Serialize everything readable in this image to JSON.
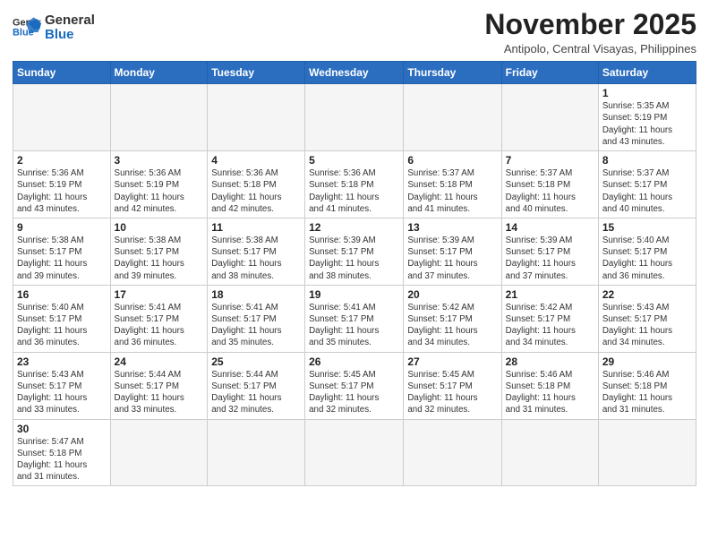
{
  "header": {
    "logo_line1": "General",
    "logo_line2": "Blue",
    "month_title": "November 2025",
    "subtitle": "Antipolo, Central Visayas, Philippines"
  },
  "weekdays": [
    "Sunday",
    "Monday",
    "Tuesday",
    "Wednesday",
    "Thursday",
    "Friday",
    "Saturday"
  ],
  "weeks": [
    [
      {
        "day": "",
        "info": ""
      },
      {
        "day": "",
        "info": ""
      },
      {
        "day": "",
        "info": ""
      },
      {
        "day": "",
        "info": ""
      },
      {
        "day": "",
        "info": ""
      },
      {
        "day": "",
        "info": ""
      },
      {
        "day": "1",
        "info": "Sunrise: 5:35 AM\nSunset: 5:19 PM\nDaylight: 11 hours\nand 43 minutes."
      }
    ],
    [
      {
        "day": "2",
        "info": "Sunrise: 5:36 AM\nSunset: 5:19 PM\nDaylight: 11 hours\nand 43 minutes."
      },
      {
        "day": "3",
        "info": "Sunrise: 5:36 AM\nSunset: 5:19 PM\nDaylight: 11 hours\nand 42 minutes."
      },
      {
        "day": "4",
        "info": "Sunrise: 5:36 AM\nSunset: 5:18 PM\nDaylight: 11 hours\nand 42 minutes."
      },
      {
        "day": "5",
        "info": "Sunrise: 5:36 AM\nSunset: 5:18 PM\nDaylight: 11 hours\nand 41 minutes."
      },
      {
        "day": "6",
        "info": "Sunrise: 5:37 AM\nSunset: 5:18 PM\nDaylight: 11 hours\nand 41 minutes."
      },
      {
        "day": "7",
        "info": "Sunrise: 5:37 AM\nSunset: 5:18 PM\nDaylight: 11 hours\nand 40 minutes."
      },
      {
        "day": "8",
        "info": "Sunrise: 5:37 AM\nSunset: 5:17 PM\nDaylight: 11 hours\nand 40 minutes."
      }
    ],
    [
      {
        "day": "9",
        "info": "Sunrise: 5:38 AM\nSunset: 5:17 PM\nDaylight: 11 hours\nand 39 minutes."
      },
      {
        "day": "10",
        "info": "Sunrise: 5:38 AM\nSunset: 5:17 PM\nDaylight: 11 hours\nand 39 minutes."
      },
      {
        "day": "11",
        "info": "Sunrise: 5:38 AM\nSunset: 5:17 PM\nDaylight: 11 hours\nand 38 minutes."
      },
      {
        "day": "12",
        "info": "Sunrise: 5:39 AM\nSunset: 5:17 PM\nDaylight: 11 hours\nand 38 minutes."
      },
      {
        "day": "13",
        "info": "Sunrise: 5:39 AM\nSunset: 5:17 PM\nDaylight: 11 hours\nand 37 minutes."
      },
      {
        "day": "14",
        "info": "Sunrise: 5:39 AM\nSunset: 5:17 PM\nDaylight: 11 hours\nand 37 minutes."
      },
      {
        "day": "15",
        "info": "Sunrise: 5:40 AM\nSunset: 5:17 PM\nDaylight: 11 hours\nand 36 minutes."
      }
    ],
    [
      {
        "day": "16",
        "info": "Sunrise: 5:40 AM\nSunset: 5:17 PM\nDaylight: 11 hours\nand 36 minutes."
      },
      {
        "day": "17",
        "info": "Sunrise: 5:41 AM\nSunset: 5:17 PM\nDaylight: 11 hours\nand 36 minutes."
      },
      {
        "day": "18",
        "info": "Sunrise: 5:41 AM\nSunset: 5:17 PM\nDaylight: 11 hours\nand 35 minutes."
      },
      {
        "day": "19",
        "info": "Sunrise: 5:41 AM\nSunset: 5:17 PM\nDaylight: 11 hours\nand 35 minutes."
      },
      {
        "day": "20",
        "info": "Sunrise: 5:42 AM\nSunset: 5:17 PM\nDaylight: 11 hours\nand 34 minutes."
      },
      {
        "day": "21",
        "info": "Sunrise: 5:42 AM\nSunset: 5:17 PM\nDaylight: 11 hours\nand 34 minutes."
      },
      {
        "day": "22",
        "info": "Sunrise: 5:43 AM\nSunset: 5:17 PM\nDaylight: 11 hours\nand 34 minutes."
      }
    ],
    [
      {
        "day": "23",
        "info": "Sunrise: 5:43 AM\nSunset: 5:17 PM\nDaylight: 11 hours\nand 33 minutes."
      },
      {
        "day": "24",
        "info": "Sunrise: 5:44 AM\nSunset: 5:17 PM\nDaylight: 11 hours\nand 33 minutes."
      },
      {
        "day": "25",
        "info": "Sunrise: 5:44 AM\nSunset: 5:17 PM\nDaylight: 11 hours\nand 32 minutes."
      },
      {
        "day": "26",
        "info": "Sunrise: 5:45 AM\nSunset: 5:17 PM\nDaylight: 11 hours\nand 32 minutes."
      },
      {
        "day": "27",
        "info": "Sunrise: 5:45 AM\nSunset: 5:17 PM\nDaylight: 11 hours\nand 32 minutes."
      },
      {
        "day": "28",
        "info": "Sunrise: 5:46 AM\nSunset: 5:18 PM\nDaylight: 11 hours\nand 31 minutes."
      },
      {
        "day": "29",
        "info": "Sunrise: 5:46 AM\nSunset: 5:18 PM\nDaylight: 11 hours\nand 31 minutes."
      }
    ],
    [
      {
        "day": "30",
        "info": "Sunrise: 5:47 AM\nSunset: 5:18 PM\nDaylight: 11 hours\nand 31 minutes."
      },
      {
        "day": "",
        "info": ""
      },
      {
        "day": "",
        "info": ""
      },
      {
        "day": "",
        "info": ""
      },
      {
        "day": "",
        "info": ""
      },
      {
        "day": "",
        "info": ""
      },
      {
        "day": "",
        "info": ""
      }
    ]
  ]
}
